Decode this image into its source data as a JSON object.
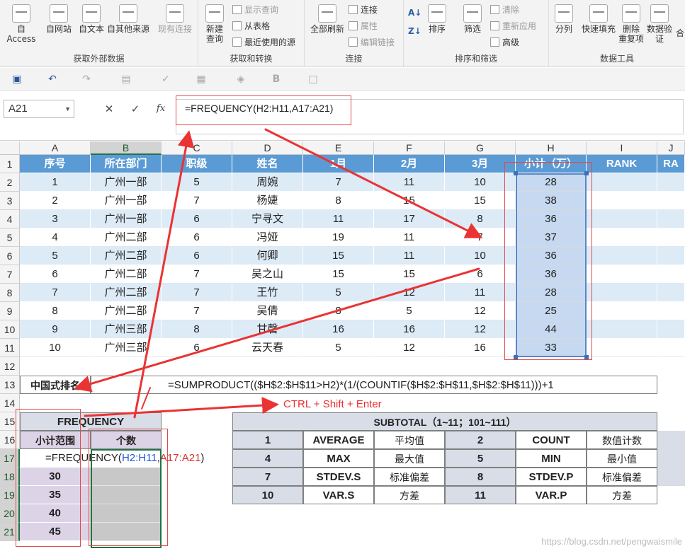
{
  "ribbon": {
    "groups": [
      {
        "title": "获取外部数据",
        "items": [
          "自 Access",
          "自网站",
          "自文本",
          "自其他来源",
          "现有连接"
        ]
      },
      {
        "title": "获取和转换",
        "big": [
          "新建",
          "查询"
        ],
        "small": [
          "显示查询",
          "从表格",
          "最近使用的源"
        ]
      },
      {
        "title": "连接",
        "big": "全部刷新",
        "small": [
          "连接",
          "属性",
          "编辑链接"
        ]
      },
      {
        "title": "排序和筛选",
        "big": [
          "排序",
          "筛选"
        ],
        "small": [
          "清除",
          "重新应用",
          "高级"
        ]
      },
      {
        "title": "数据工具",
        "items": [
          "分列",
          "快速填充",
          "删除",
          "重复项",
          "数据验",
          "证"
        ],
        "extra": "合"
      }
    ],
    "sort_icon_letters": [
      "A Z",
      "Z A"
    ],
    "sort_small": [
      "A↓",
      "Z↓"
    ]
  },
  "qat": {
    "bold_label": "B"
  },
  "formula_bar": {
    "name_box": "A21",
    "fx": "fx",
    "formula": "=FREQUENCY(H2:H11,A17:A21)"
  },
  "sheet": {
    "columns": [
      "A",
      "B",
      "C",
      "D",
      "E",
      "F",
      "G",
      "H",
      "I",
      "J"
    ],
    "rows": [
      "1",
      "2",
      "3",
      "4",
      "5",
      "6",
      "7",
      "8",
      "9",
      "10",
      "11",
      "12",
      "13",
      "14",
      "15",
      "16",
      "17",
      "18",
      "19",
      "20",
      "21"
    ],
    "header": [
      "序号",
      "所在部门",
      "职级",
      "姓名",
      "1月",
      "2月",
      "3月",
      "小计（万）",
      "RANK",
      "RA"
    ],
    "data": [
      [
        "1",
        "广州一部",
        "5",
        "周婉",
        "7",
        "11",
        "10",
        "28"
      ],
      [
        "2",
        "广州一部",
        "7",
        "杨婕",
        "8",
        "15",
        "15",
        "38"
      ],
      [
        "3",
        "广州一部",
        "6",
        "宁寻文",
        "11",
        "17",
        "8",
        "36"
      ],
      [
        "4",
        "广州二部",
        "6",
        "冯娅",
        "19",
        "11",
        "7",
        "37"
      ],
      [
        "5",
        "广州二部",
        "6",
        "何卿",
        "15",
        "11",
        "10",
        "36"
      ],
      [
        "6",
        "广州二部",
        "7",
        "吴之山",
        "15",
        "15",
        "6",
        "36"
      ],
      [
        "7",
        "广州二部",
        "7",
        "王竹",
        "5",
        "12",
        "11",
        "28"
      ],
      [
        "8",
        "广州二部",
        "7",
        "吴倩",
        "8",
        "5",
        "12",
        "25"
      ],
      [
        "9",
        "广州三部",
        "8",
        "甘磬",
        "16",
        "16",
        "12",
        "44"
      ],
      [
        "10",
        "广州三部",
        "6",
        "云天春",
        "5",
        "12",
        "16",
        "33"
      ]
    ],
    "rank_label": "中国式排名",
    "rank_formula": "=SUMPRODUCT(($H$2:$H$11>H2)*(1/(COUNTIF($H$2:$H$11,$H$2:$H$11)))+1",
    "note": "CTRL + Shift + Enter",
    "freq_title": "FREQUENCY",
    "freq_headers": [
      "小计范围",
      "个数"
    ],
    "freq_formula_prefix": "=FREQUENCY(",
    "freq_ref1": "H2:H11",
    "freq_comma": ",",
    "freq_ref2": "A17:A21",
    "freq_suffix": ")",
    "freq_bins": [
      "30",
      "35",
      "40",
      "45"
    ],
    "subtotal_title": "SUBTOTAL（1~11；101~111）",
    "subtotal_rows": [
      [
        "1",
        "AVERAGE",
        "平均值",
        "2",
        "COUNT",
        "数值计数"
      ],
      [
        "4",
        "MAX",
        "最大值",
        "5",
        "MIN",
        "最小值"
      ],
      [
        "7",
        "STDEV.S",
        "标准偏差",
        "8",
        "STDEV.P",
        "标准偏差"
      ],
      [
        "10",
        "VAR.S",
        "方差",
        "11",
        "VAR.P",
        "方差"
      ]
    ]
  },
  "watermark": "https://blog.csdn.net/pengwaismile",
  "colors": {
    "header_blue": "#5b9bd5",
    "light_blue": "#ddebf7",
    "annotation_red": "#e8302f",
    "excel_green": "#217346"
  }
}
